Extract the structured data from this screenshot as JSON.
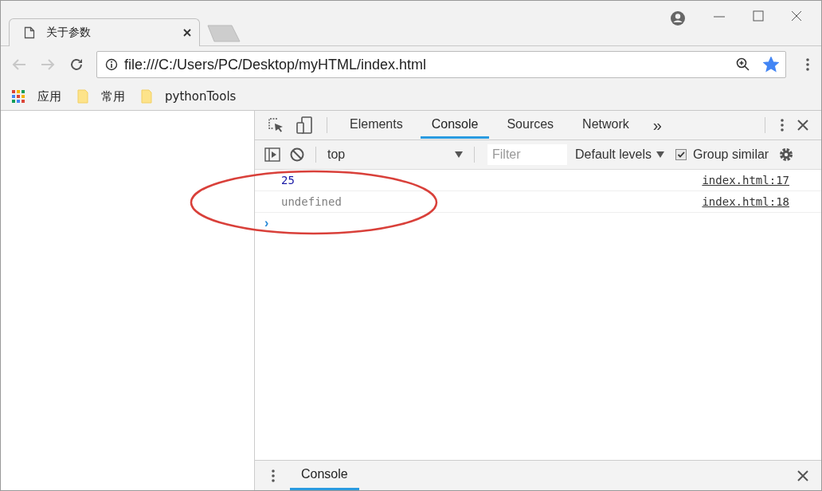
{
  "browser_tab": {
    "title": "关于参数",
    "selected": true
  },
  "address_bar": {
    "url": "file:///C:/Users/PC/Desktop/myHTML/index.html",
    "bookmarked": true
  },
  "bookmarks": [
    {
      "kind": "apps",
      "label": "应用"
    },
    {
      "kind": "folder",
      "label": "常用"
    },
    {
      "kind": "folder",
      "label": "pythonTools"
    }
  ],
  "devtools": {
    "tabs": [
      {
        "label": "Elements",
        "selected": false
      },
      {
        "label": "Console",
        "selected": true
      },
      {
        "label": "Sources",
        "selected": false
      },
      {
        "label": "Network",
        "selected": false
      }
    ],
    "more_tabs": "»",
    "console_toolbar": {
      "context": "top",
      "filter": {
        "placeholder": "Filter"
      },
      "levels": "Default levels",
      "group_similar": {
        "label": "Group similar",
        "checked": true
      }
    },
    "messages": [
      {
        "kind": "number",
        "text": "25",
        "source": "index.html:17"
      },
      {
        "kind": "undefined",
        "text": "undefined",
        "source": "index.html:18"
      }
    ],
    "prompt": "›",
    "drawer": {
      "tabs": [
        {
          "label": "Console",
          "selected": true
        }
      ]
    }
  },
  "annotations": [
    {
      "kind": "ellipse"
    }
  ]
}
